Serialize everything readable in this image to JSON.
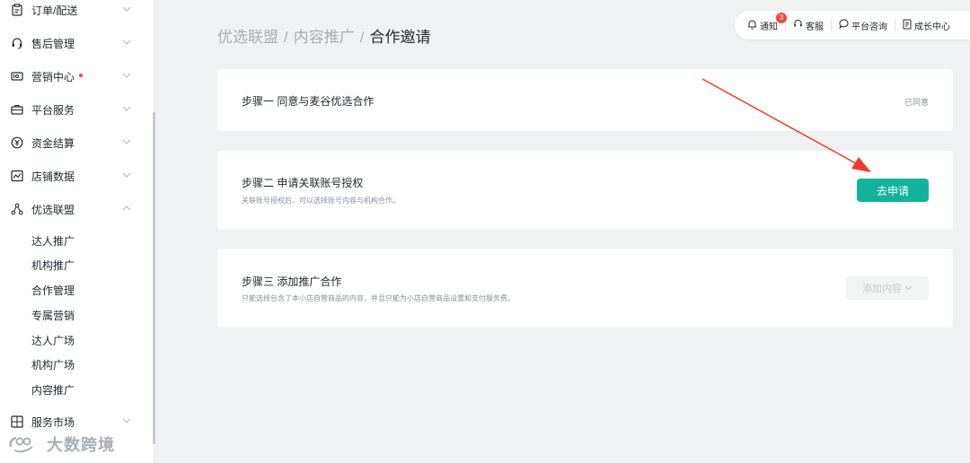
{
  "sidebar": {
    "items": [
      {
        "label": "订单/配送",
        "icon": "clipboard-icon"
      },
      {
        "label": "售后管理",
        "icon": "headset-icon"
      },
      {
        "label": "营销中心",
        "icon": "coupon-icon",
        "dot": true
      },
      {
        "label": "平台服务",
        "icon": "briefcase-icon"
      },
      {
        "label": "资金结算",
        "icon": "yen-icon"
      },
      {
        "label": "店铺数据",
        "icon": "chart-icon"
      },
      {
        "label": "优选联盟",
        "icon": "network-icon",
        "expanded": true
      },
      {
        "label": "服务市场",
        "icon": "grid-icon"
      }
    ],
    "sub_items": [
      "达人推广",
      "机构推广",
      "合作管理",
      "专属营销",
      "达人广场",
      "机构广场",
      "内容推广"
    ]
  },
  "watermark": "大数跨境",
  "breadcrumb": {
    "crumb1": "优选联盟",
    "crumb2": "内容推广",
    "current": "合作邀请",
    "sep": "/"
  },
  "topbar": {
    "notify": "通知",
    "notify_count": "3",
    "service": "客服",
    "consult": "平台咨询",
    "growth": "成长中心"
  },
  "steps": {
    "step1": {
      "title": "步骤一 同意与麦谷优选合作",
      "status": "已同意"
    },
    "step2": {
      "title": "步骤二 申请关联账号授权",
      "desc": "关联账号授权后，可以选择账号内容与机构合作。",
      "button": "去申请"
    },
    "step3": {
      "title": "步骤三 添加推广合作",
      "desc": "只能选择包含了本小店自营商品的内容，并且只能为小店自营商品设置和支付服务费。",
      "button": "添加内容"
    }
  },
  "colors": {
    "accent": "#13b39b",
    "badge": "#f5463b",
    "annotation_arrow": "#ef3b2d"
  }
}
